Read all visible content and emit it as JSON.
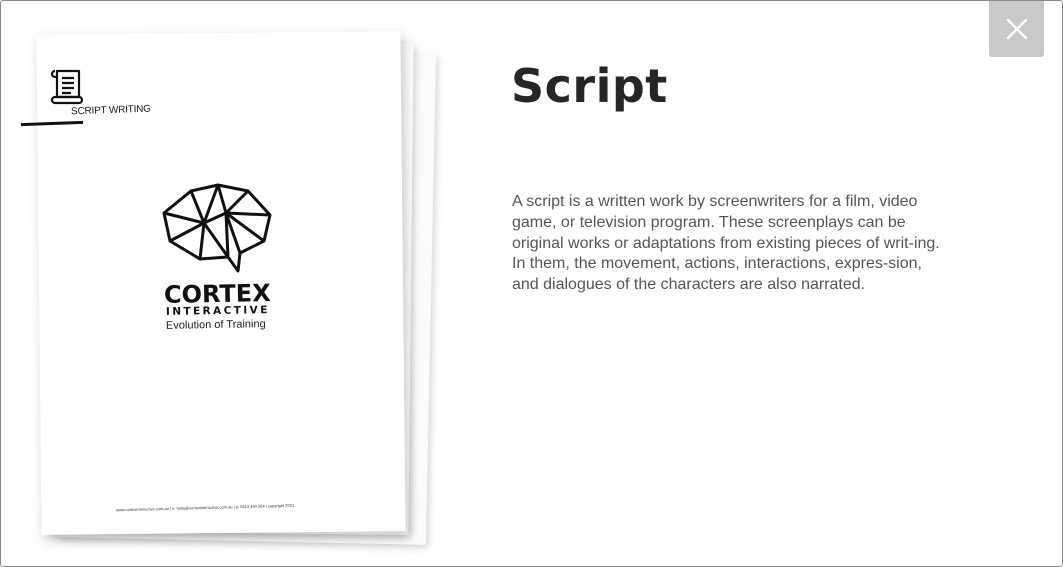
{
  "modal": {
    "title": "Script",
    "description": "A script is a written work by screenwriters for a film, video game, or television program. These screenplays can be original works or adaptations from existing pieces of writ-ing. In them, the movement, actions, interactions, expres-sion, and dialogues of the characters are also narrated.",
    "close_icon": "close-icon"
  },
  "document": {
    "tag_icon": "scroll-icon",
    "tag_label": "SCRIPT WRITING",
    "logo_icon": "brain-icon",
    "brand_name": "CORTEX",
    "brand_sub": "INTERACTIVE",
    "brand_tagline": "Evolution of Training",
    "footer": "www.cortexinteractive.com.au | e: hello@cortexinteractive.com.au | p: 0413 444 264 | copyright 2021"
  },
  "colors": {
    "close_button_bg": "#c9c9c9",
    "title": "#262626",
    "body_text": "#555555",
    "border": "#8a8a8a"
  }
}
